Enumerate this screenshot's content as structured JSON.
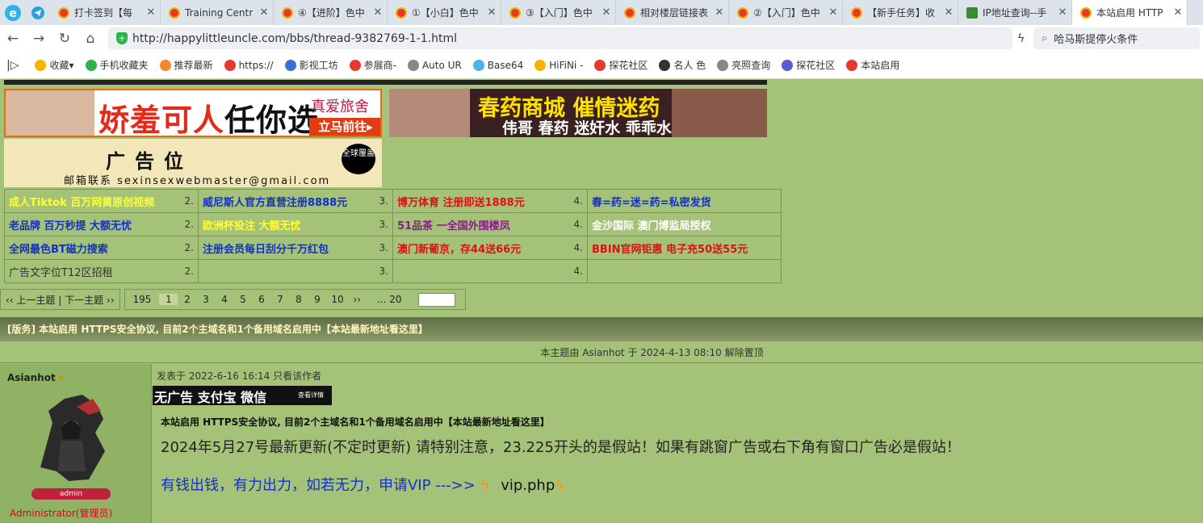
{
  "tabs": [
    {
      "label": "打卡签到【每",
      "icon": "site-favicon"
    },
    {
      "label": "Training Centr",
      "icon": "site-favicon"
    },
    {
      "label": "④【进阶】色中",
      "icon": "site-favicon"
    },
    {
      "label": "①【小白】色中",
      "icon": "site-favicon"
    },
    {
      "label": "③【入门】色中",
      "icon": "site-favicon"
    },
    {
      "label": "相对楼层链接表",
      "icon": "site-favicon"
    },
    {
      "label": "②【入门】色中",
      "icon": "site-favicon"
    },
    {
      "label": "【新手任务】收",
      "icon": "site-favicon"
    },
    {
      "label": "IP地址查询--手",
      "icon": "ip-favicon"
    },
    {
      "label": "本站启用 HTTP",
      "icon": "site-favicon",
      "active": true
    }
  ],
  "url": "http://happylittleuncle.com/bbs/thread-9382769-1-1.html",
  "search_placeholder": "哈马斯提停火条件",
  "bookmarks": [
    "收藏",
    "手机收藏夹",
    "推荐最新",
    "https://",
    "影视工坊",
    "参展商-",
    "Auto UR",
    "Base64",
    "HiFiNi -",
    "探花社区",
    "名人 色",
    "亮照查询",
    "探花社区",
    "本站启用"
  ],
  "ads": {
    "banner1_headline": "娇羞可人",
    "banner1_sub": "任你选",
    "banner1_tag1": "真爱旅舍",
    "banner1_tag2": "立马前往▸",
    "banner2_line1": "春药商城 催情迷药",
    "banner2_line2": "伟哥 春药 迷奸水 乖乖水",
    "banner3_title": "广告位",
    "banner3_contact": "邮箱联系  sexinsexwebmaster@gmail.com",
    "banner3_badge": "全球覆盖"
  },
  "ad_table": [
    [
      {
        "text": "成人Tiktok 百万网黄原创视频",
        "num": "2.",
        "color": "#ffff33"
      },
      {
        "text": "威尼斯人官方直营注册8888元",
        "num": "3.",
        "color": "#1230c8"
      },
      {
        "text": "博万体育 注册即送1888元",
        "num": "4.",
        "color": "#e01010"
      },
      {
        "text": "春=药=迷=药=私密发货",
        "num": "",
        "color": "#1230c8"
      }
    ],
    [
      {
        "text": "老品牌 百万秒提 大额无忧",
        "num": "2.",
        "color": "#1230c8"
      },
      {
        "text": "欧洲杯投注 大额无忧",
        "num": "3.",
        "color": "#ffff33"
      },
      {
        "text": "51品茶 一全国外围楼凤",
        "num": "4.",
        "color": "#8a1a8a"
      },
      {
        "text": "金沙国际 澳门博监局授权",
        "num": "",
        "color": "#ffffff"
      }
    ],
    [
      {
        "text": "全网最色BT磁力搜索",
        "num": "2.",
        "color": "#1230c8"
      },
      {
        "text": "注册会员每日刮分千万红包",
        "num": "3.",
        "color": "#1230c8"
      },
      {
        "text": "澳门新葡京，存44送66元",
        "num": "4.",
        "color": "#e01010"
      },
      {
        "text": "BBIN官网钜惠 电子充50送55元",
        "num": "",
        "color": "#e01010"
      }
    ],
    [
      {
        "text": "广告文字位T12区招租",
        "num": "2.",
        "color": "#333333"
      },
      {
        "text": "",
        "num": "3.",
        "color": "#333333"
      },
      {
        "text": "",
        "num": "4.",
        "color": "#333333"
      },
      {
        "text": "",
        "num": "",
        "color": "#333333"
      }
    ]
  ],
  "pager": {
    "prev_next": "‹‹ 上一主题 | 下一主题 ››",
    "total": "195",
    "pages": [
      "1",
      "2",
      "3",
      "4",
      "5",
      "6",
      "7",
      "8",
      "9",
      "10"
    ],
    "current": "1",
    "next": "››",
    "last": "... 20"
  },
  "notice": "[版务] 本站启用 HTTPS安全协议, 目前2个主域名和1个备用域名启用中【本站最新地址看这里】",
  "unpin": "本主题由 Asianhot 于 2024-4-13 08:10 解除置顶",
  "author": {
    "name": "Asianhot",
    "rank": "admin",
    "group": "Administrator(管理员)"
  },
  "post": {
    "meta": "发表于 2022-6-16 16:14  只看该作者",
    "banner": "无广告 支付宝 微信",
    "banner_small": "查看详情",
    "title": "本站启用 HTTPS安全协议, 目前2个主域名和1个备用域名启用中【本站最新地址看这里】",
    "body": "2024年5月27号最新更新(不定时更新) 请特别注意，23.225开头的是假站！如果有跳窗广告或右下角有窗口广告必是假站！",
    "vip": "有钱出钱，有力出力，如若无力，申请VIP --->>",
    "vip_link": "vip.php"
  }
}
